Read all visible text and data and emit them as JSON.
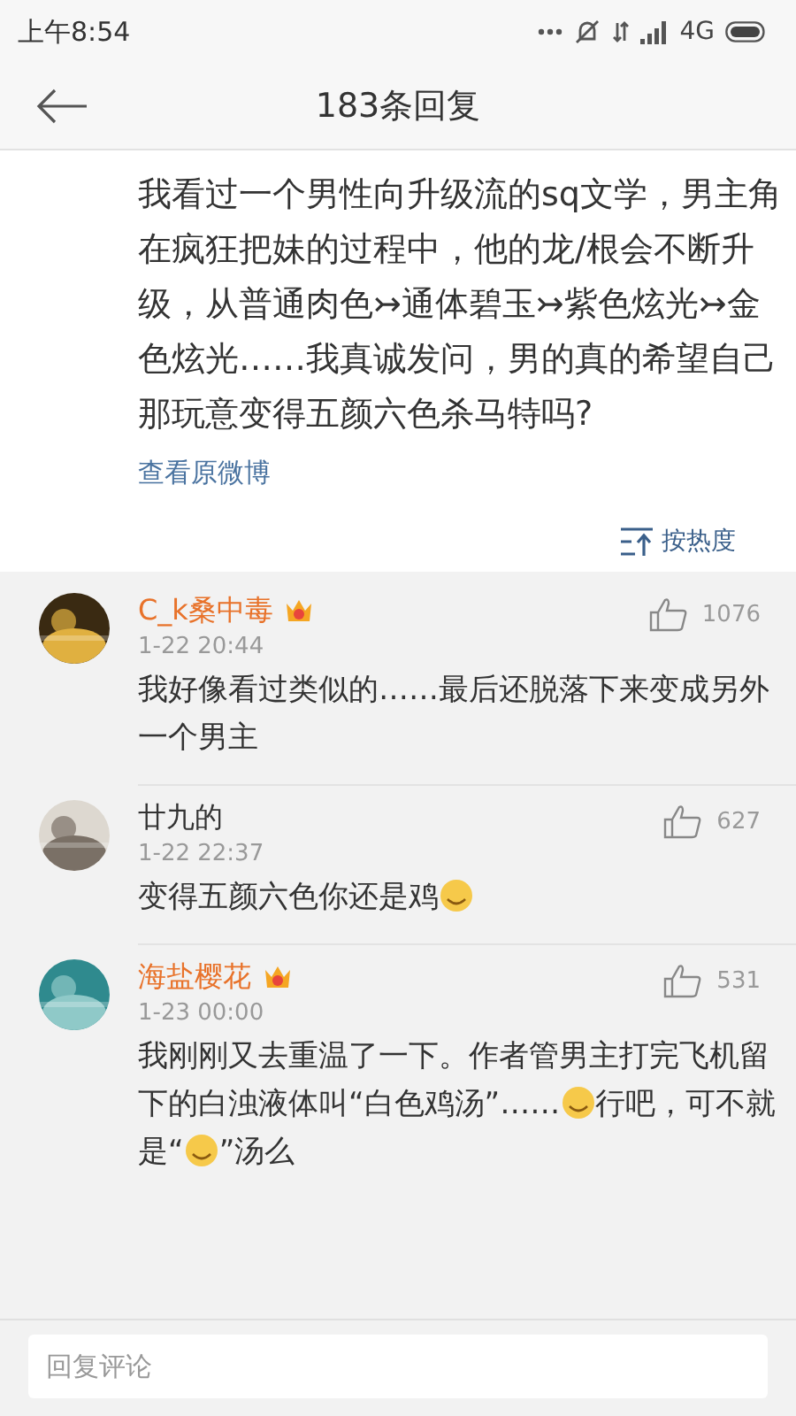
{
  "status_bar": {
    "time": "上午8:54",
    "network": "4G"
  },
  "header": {
    "title": "183条回复"
  },
  "post": {
    "text": "我看过一个男性向升级流的sq文学，男主角在疯狂把妹的过程中，他的龙/根会不断升级，从普通肉色↣通体碧玉↣紫色炫光↣金色炫光……我真诚发问，男的真的希望自己那玩意变得五颜六色杀马特吗?",
    "link": "查看原微博",
    "sort": "按热度"
  },
  "comments": [
    {
      "name": "C_k桑中毒",
      "badge": true,
      "time": "1-22 20:44",
      "likes": "1076",
      "parts": [
        {
          "kind": "text",
          "text": "我好像看过类似的……最后还脱落下来变成另外一个男主"
        }
      ]
    },
    {
      "name": "廿九的",
      "badge": false,
      "time": "1-22 22:37",
      "likes": "627",
      "parts": [
        {
          "kind": "text",
          "text": "变得五颜六色你还是鸡"
        },
        {
          "kind": "emoji"
        }
      ]
    },
    {
      "name": "海盐樱花",
      "badge": true,
      "time": "1-23 00:00",
      "likes": "531",
      "parts": [
        {
          "kind": "text",
          "text": "我刚刚又去重温了一下。作者管男主打完飞机留下的白浊液体叫“白色鸡汤”……"
        },
        {
          "kind": "emoji"
        },
        {
          "kind": "text",
          "text": "行吧，可不就是“"
        },
        {
          "kind": "emoji"
        },
        {
          "kind": "text",
          "text": "”汤么"
        }
      ]
    }
  ],
  "reply_box": {
    "placeholder": "回复评论"
  }
}
